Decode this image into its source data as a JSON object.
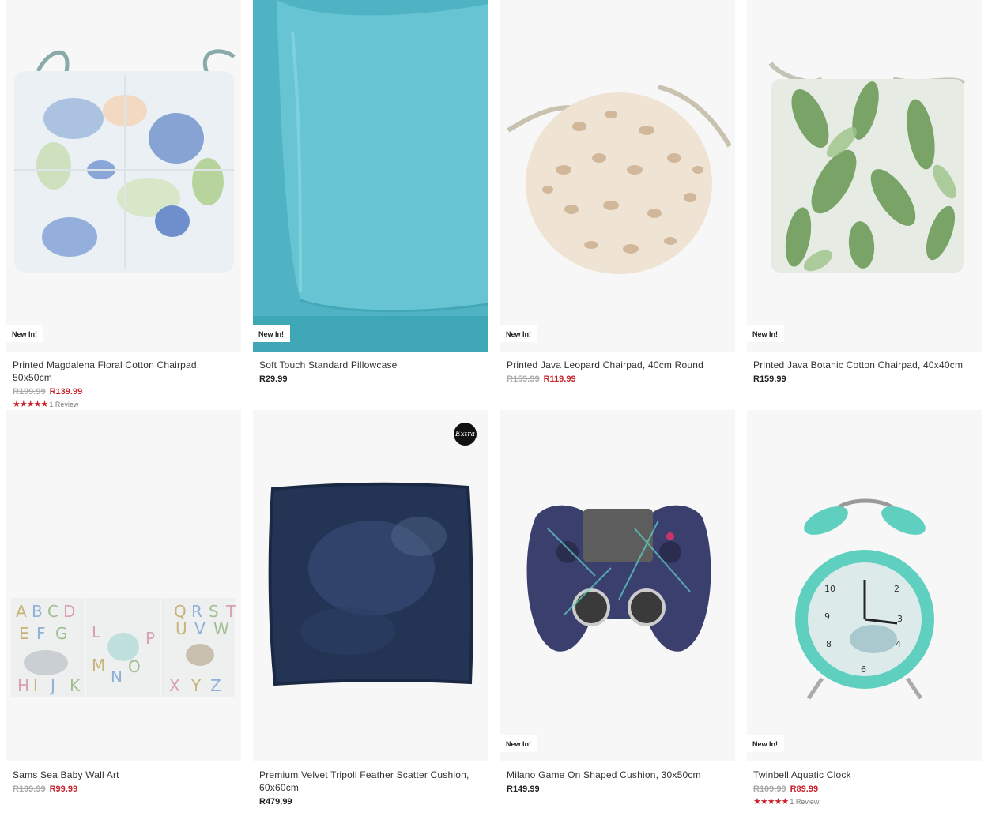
{
  "products": [
    {
      "title": "Printed Magdalena Floral Cotton Chairpad, 50x50cm",
      "old_price": "R199.99",
      "price": "R139.99",
      "badge": "New In!",
      "stars": "★★★★★",
      "reviews": "1 Review"
    },
    {
      "title": "Soft Touch Standard Pillowcase",
      "price": "R29.99",
      "badge": "New In!"
    },
    {
      "title": "Printed Java Leopard Chairpad, 40cm Round",
      "old_price": "R159.99",
      "price": "R119.99",
      "badge": "New In!"
    },
    {
      "title": "Printed Java Botanic Cotton Chairpad, 40x40cm",
      "price": "R159.99",
      "badge": "New In!"
    },
    {
      "title": "Sams Sea Baby Wall Art",
      "old_price": "R199.99",
      "price": "R99.99"
    },
    {
      "title": "Premium Velvet Tripoli Feather Scatter Cushion, 60x60cm",
      "price": "R479.99",
      "brand_mark": "Extra"
    },
    {
      "title": "Milano Game On Shaped Cushion, 30x50cm",
      "price": "R149.99",
      "badge": "New In!"
    },
    {
      "title": "Twinbell Aquatic Clock",
      "old_price": "R109.99",
      "price": "R89.99",
      "badge": "New In!",
      "stars": "★★★★★",
      "reviews": "1 Review"
    }
  ],
  "wall_art_letters": [
    "A",
    "B",
    "C",
    "D",
    "E",
    "F",
    "G",
    "H",
    "I",
    "J",
    "K",
    "L",
    "M",
    "N",
    "O",
    "P",
    "Q",
    "R",
    "S",
    "T",
    "U",
    "V",
    "W",
    "X",
    "Y",
    "Z"
  ],
  "clock_numbers": [
    "10",
    "2",
    "9",
    "3",
    "8",
    "4",
    "6"
  ],
  "colors": {
    "sale": "#c8232c",
    "card_bg": "#f7f7f7",
    "pillow": "#5bbccb",
    "clock": "#5fd0c0"
  }
}
